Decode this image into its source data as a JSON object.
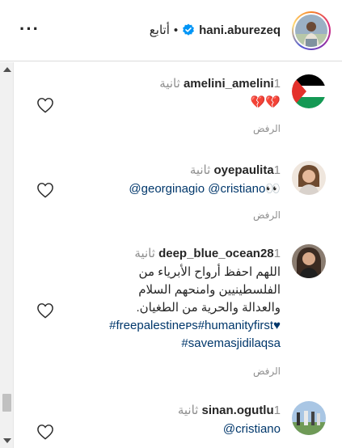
{
  "header": {
    "username": "hani.aburezeq",
    "separator": "•",
    "follow_label": "أتابع",
    "more_label": "···"
  },
  "comments": [
    {
      "username": "amelini_amelini",
      "time": "1 ثانية",
      "text_emoji": "💔💔",
      "reply_label": "الرفض"
    },
    {
      "username": "oyepaulita",
      "time": "1 ثانية",
      "mention1": "@georginagio",
      "mention2": "@cristiano",
      "emoji": "👀",
      "reply_label": "الرفض"
    },
    {
      "username": "deep_blue_ocean28",
      "time": "1 ثانية",
      "text_line1": "اللهم احفظ أرواح الأبرياء من",
      "text_line2": "الفلسطينيين وامنحهم السلام",
      "text_line3": "والعدالة والحرية من الطغيان.",
      "hashtag1": "#freepalestineᴘs",
      "hashtag2": "#humanityfirst♥",
      "hashtag3": "#savemasjidilaqsa",
      "reply_label": "الرفض"
    },
    {
      "username": "sinan.ogutlu",
      "time": "1 ثانية",
      "mention1": "@cristiano"
    }
  ],
  "icons": {
    "more": "more-options-icon",
    "verified": "verified-badge-icon",
    "like": "heart-outline-icon"
  },
  "colors": {
    "mention": "#00376b",
    "muted": "#8e8e8e",
    "text": "#262626",
    "verified": "#0095f6",
    "divider": "#dbdbdb"
  }
}
